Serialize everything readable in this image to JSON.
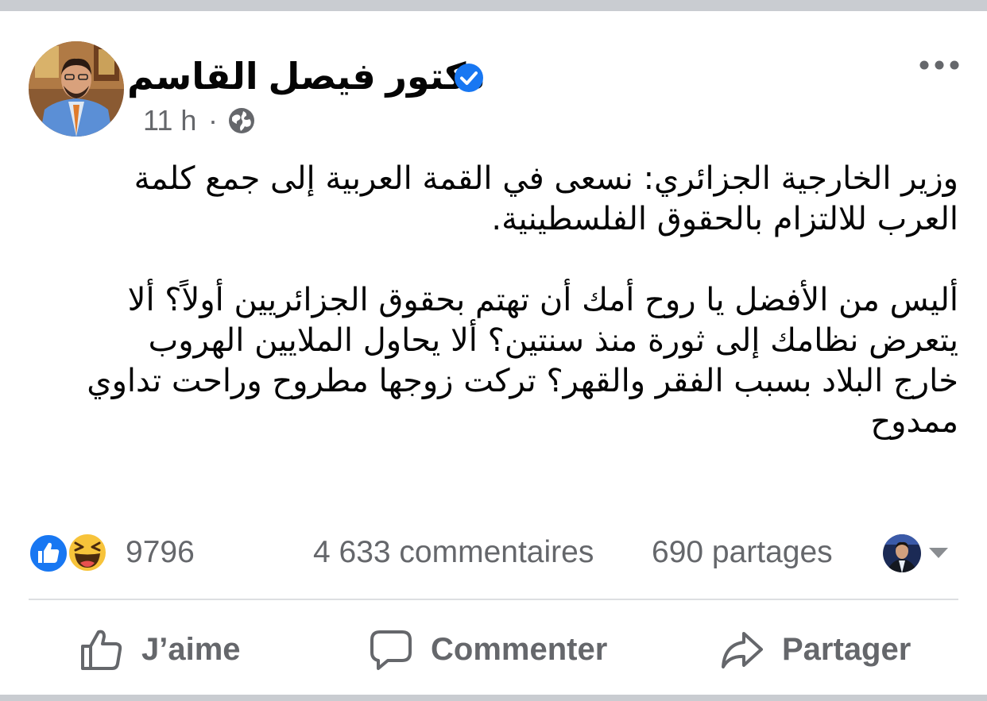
{
  "post": {
    "author": "دكتور فيصل القاسم",
    "time": "11 h",
    "separator": "·",
    "audience_icon": "globe-icon",
    "verified_icon": "verified-badge-icon",
    "text_lines": [
      "وزير الخارجية الجزائري: نسعى في القمة العربية إلى جمع كلمة",
      "العرب للالتزام بالحقوق الفلسطينية.",
      "أليس من الأفضل يا روح أمك أن تهتم بحقوق الجزائريين أولاً؟ ألا",
      "يتعرض نظامك إلى ثورة منذ سنتين؟ ألا يحاول الملايين الهروب",
      "خارج البلاد بسبب الفقر والقهر؟ تركت زوجها مطروح وراحت تداوي",
      "ممدوح"
    ]
  },
  "stats": {
    "reactions": "9796",
    "comments": "4 633 commentaires",
    "shares": "690 partages"
  },
  "actions": {
    "like": "J’aime",
    "comment": "Commenter",
    "share": "Partager"
  },
  "colors": {
    "accent": "#1877f2",
    "secondary_text": "#65676b",
    "primary_text": "#050505",
    "haha": "#f7c33a",
    "divider": "#dddfe2"
  }
}
